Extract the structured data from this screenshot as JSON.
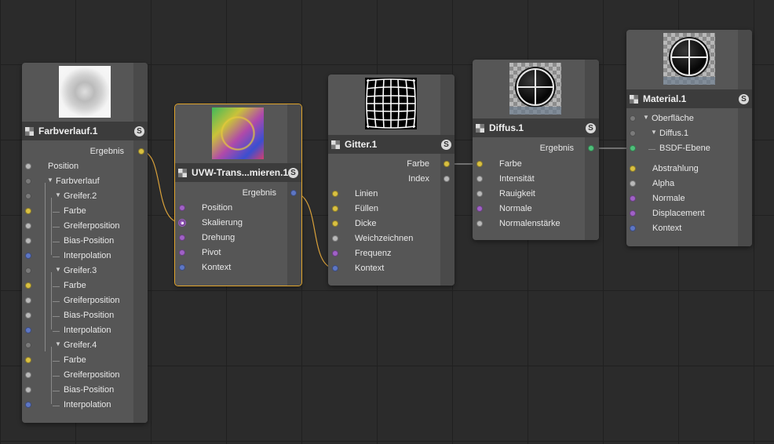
{
  "nodes": {
    "farbverlauf": {
      "title": "Farbverlauf.1",
      "output": "Ergebnis",
      "inputs": [
        {
          "label": "Position",
          "indent": 0,
          "port": "gray"
        },
        {
          "label": "Farbverlauf",
          "indent": 0,
          "port": "dark",
          "expand": true
        },
        {
          "label": "Greifer.2",
          "indent": 1,
          "port": "dark",
          "expand": true
        },
        {
          "label": "Farbe",
          "indent": 2,
          "port": "yellow"
        },
        {
          "label": "Greiferposition",
          "indent": 2,
          "port": "gray"
        },
        {
          "label": "Bias-Position",
          "indent": 2,
          "port": "gray"
        },
        {
          "label": "Interpolation",
          "indent": 2,
          "port": "blue"
        },
        {
          "label": "Greifer.3",
          "indent": 1,
          "port": "dark",
          "expand": true
        },
        {
          "label": "Farbe",
          "indent": 2,
          "port": "yellow"
        },
        {
          "label": "Greiferposition",
          "indent": 2,
          "port": "gray"
        },
        {
          "label": "Bias-Position",
          "indent": 2,
          "port": "gray"
        },
        {
          "label": "Interpolation",
          "indent": 2,
          "port": "blue"
        },
        {
          "label": "Greifer.4",
          "indent": 1,
          "port": "dark",
          "expand": true
        },
        {
          "label": "Farbe",
          "indent": 2,
          "port": "yellow"
        },
        {
          "label": "Greiferposition",
          "indent": 2,
          "port": "gray"
        },
        {
          "label": "Bias-Position",
          "indent": 2,
          "port": "gray"
        },
        {
          "label": "Interpolation",
          "indent": 2,
          "port": "blue"
        }
      ]
    },
    "uvw": {
      "title": "UVW-Trans...mieren.1",
      "output": "Ergebnis",
      "inputs": [
        {
          "label": "Position",
          "port": "purple"
        },
        {
          "label": "Skalierung",
          "port": "active"
        },
        {
          "label": "Drehung",
          "port": "purple"
        },
        {
          "label": "Pivot",
          "port": "purple"
        },
        {
          "label": "Kontext",
          "port": "blue"
        }
      ]
    },
    "gitter": {
      "title": "Gitter.1",
      "outputs": [
        "Farbe",
        "Index"
      ],
      "inputs": [
        {
          "label": "Linien",
          "port": "yellow"
        },
        {
          "label": "Füllen",
          "port": "yellow"
        },
        {
          "label": "Dicke",
          "port": "yellow"
        },
        {
          "label": "Weichzeichnen",
          "port": "gray"
        },
        {
          "label": "Frequenz",
          "port": "purple"
        },
        {
          "label": "Kontext",
          "port": "blue"
        }
      ]
    },
    "diffus": {
      "title": "Diffus.1",
      "output": "Ergebnis",
      "inputs": [
        {
          "label": "Farbe",
          "port": "yellow"
        },
        {
          "label": "Intensität",
          "port": "gray"
        },
        {
          "label": "Rauigkeit",
          "port": "gray"
        },
        {
          "label": "Normale",
          "port": "purple"
        },
        {
          "label": "Normalenstärke",
          "port": "gray"
        }
      ]
    },
    "material": {
      "title": "Material.1",
      "tree": [
        {
          "label": "Oberfläche",
          "indent": 0,
          "port": "dark",
          "expand": true
        },
        {
          "label": "Diffus.1",
          "indent": 1,
          "port": "dark",
          "expand": true
        },
        {
          "label": "BSDF-Ebene",
          "indent": 2,
          "port": "green"
        }
      ],
      "inputs": [
        {
          "label": "Abstrahlung",
          "port": "yellow"
        },
        {
          "label": "Alpha",
          "port": "gray"
        },
        {
          "label": "Normale",
          "port": "purple"
        },
        {
          "label": "Displacement",
          "port": "purple"
        },
        {
          "label": "Kontext",
          "port": "blue"
        }
      ]
    }
  },
  "badge": "S",
  "colors": {
    "yellow": "#d9c041",
    "gray": "#b9b9b9",
    "blue": "#5d76c4",
    "purple": "#a061c6",
    "green": "#4fbf7a",
    "wire_orange": "#d9a13a",
    "wire_gray": "#9a9a9a",
    "selection": "#e0a42c"
  }
}
